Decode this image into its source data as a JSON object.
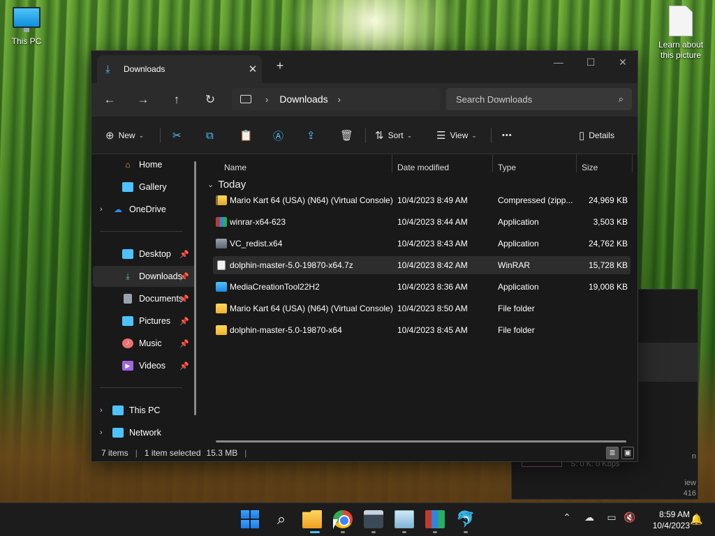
{
  "desktop": {
    "icons": [
      {
        "label": "This PC",
        "icon": "monitor-icon"
      },
      {
        "label": "Learn about this picture",
        "icon": "document-icon"
      }
    ]
  },
  "window": {
    "tab": {
      "title": "Downloads",
      "icon": "download-arrow-icon",
      "close": "✕"
    },
    "new_tab": "+",
    "controls": {
      "minimize": "—",
      "maximize": "☐",
      "close": "✕"
    },
    "nav": {
      "back": "←",
      "forward": "→",
      "up": "↑",
      "refresh": "↻"
    },
    "breadcrumb": {
      "segment": "Downloads"
    },
    "search": {
      "placeholder": "Search Downloads"
    },
    "commands": {
      "new": "New",
      "sort": "Sort",
      "view": "View",
      "more": "•••",
      "details": "Details"
    },
    "sidebar": {
      "top": [
        {
          "label": "Home",
          "icon": "home-icon",
          "color": "#f0a050"
        },
        {
          "label": "Gallery",
          "icon": "gallery-icon",
          "color": "#4cc2ff"
        },
        {
          "label": "OneDrive",
          "icon": "cloud-icon",
          "color": "#2e8ae6",
          "expandable": true
        }
      ],
      "pinned": [
        {
          "label": "Desktop",
          "icon": "desktop-icon",
          "color": "#4cc2ff"
        },
        {
          "label": "Downloads",
          "icon": "download-icon",
          "color": "#4cd6a0",
          "selected": true
        },
        {
          "label": "Documents",
          "icon": "documents-icon",
          "color": "#9aa3ad"
        },
        {
          "label": "Pictures",
          "icon": "pictures-icon",
          "color": "#4cc2ff"
        },
        {
          "label": "Music",
          "icon": "music-icon",
          "color": "#f07070"
        },
        {
          "label": "Videos",
          "icon": "videos-icon",
          "color": "#a066e0"
        }
      ],
      "bottom": [
        {
          "label": "This PC",
          "icon": "pc-icon",
          "color": "#4cc2ff"
        },
        {
          "label": "Network",
          "icon": "network-icon",
          "color": "#4cc2ff"
        }
      ]
    },
    "columns": {
      "name": "Name",
      "date": "Date modified",
      "type": "Type",
      "size": "Size"
    },
    "group": "Today",
    "files": [
      {
        "name": "Mario Kart 64 (USA) (N64) (Virtual Console)",
        "date": "10/4/2023 8:49 AM",
        "type": "Compressed (zipp...",
        "size": "24,969 KB",
        "icon": "zip-folder-icon"
      },
      {
        "name": "winrar-x64-623",
        "date": "10/4/2023 8:44 AM",
        "type": "Application",
        "size": "3,503 KB",
        "icon": "winrar-icon"
      },
      {
        "name": "VC_redist.x64",
        "date": "10/4/2023 8:43 AM",
        "type": "Application",
        "size": "24,762 KB",
        "icon": "installer-icon"
      },
      {
        "name": "dolphin-master-5.0-19870-x64.7z",
        "date": "10/4/2023 8:42 AM",
        "type": "WinRAR",
        "size": "15,728 KB",
        "icon": "archive-file-icon",
        "selected": true
      },
      {
        "name": "MediaCreationTool22H2",
        "date": "10/4/2023 8:36 AM",
        "type": "Application",
        "size": "19,008 KB",
        "icon": "media-creation-icon"
      },
      {
        "name": "Mario Kart 64 (USA) (N64) (Virtual Console)",
        "date": "10/4/2023 8:50 AM",
        "type": "File folder",
        "size": "",
        "icon": "folder-icon"
      },
      {
        "name": "dolphin-master-5.0-19870-x64",
        "date": "10/4/2023 8:45 AM",
        "type": "File folder",
        "size": "",
        "icon": "folder-icon"
      }
    ],
    "status": {
      "items": "7 items",
      "selected": "1 item selected",
      "size": "15.3 MB"
    }
  },
  "background_window": {
    "stat": "S: 0 K: 0 Kbps",
    "edge_texts": [
      "n",
      "iew",
      "416"
    ]
  },
  "taskbar": {
    "apps": [
      "start-icon",
      "search-icon",
      "file-explorer-icon",
      "chrome-icon",
      "terminal-icon",
      "resource-monitor-icon",
      "winrar-icon",
      "dolphin-icon"
    ],
    "clock": {
      "time": "8:59 AM",
      "date": "10/4/2023"
    }
  }
}
